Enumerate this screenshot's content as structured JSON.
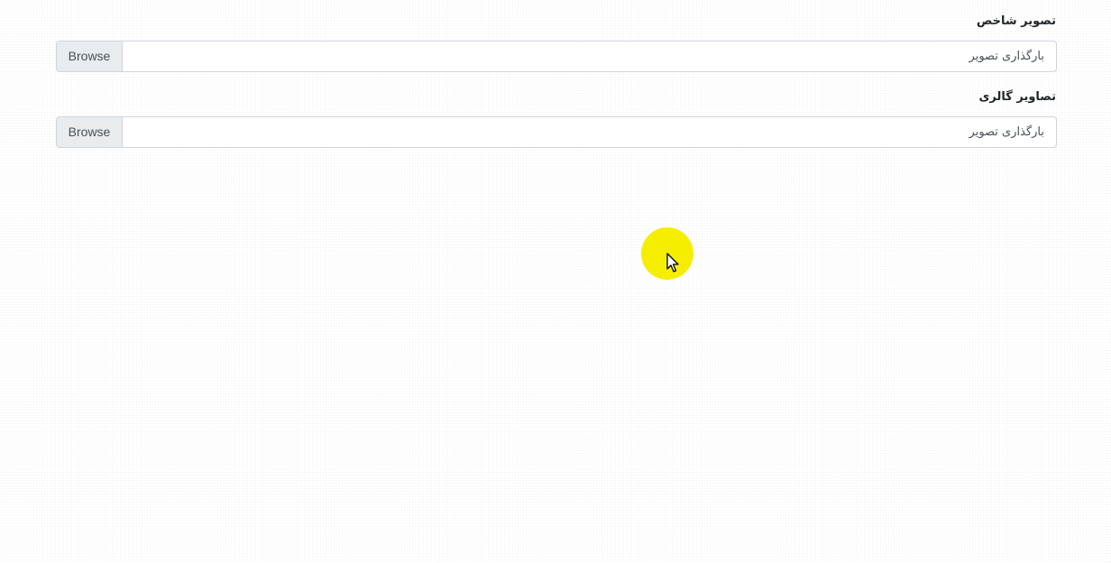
{
  "form": {
    "featured_image": {
      "label": "تصویر شاخص",
      "placeholder": "بارگذاری تصویر",
      "browse_label": "Browse"
    },
    "gallery_images": {
      "label": "تصاویر گالری",
      "placeholder": "بارگذاری تصویر",
      "browse_label": "Browse"
    }
  },
  "cursor": {
    "icon": "arrow-pointer-icon",
    "highlight_color": "#f5ee00"
  },
  "colors": {
    "button_bg": "#e9ecef",
    "border": "#ced4da",
    "label_text": "#212529",
    "input_text": "#495057"
  }
}
